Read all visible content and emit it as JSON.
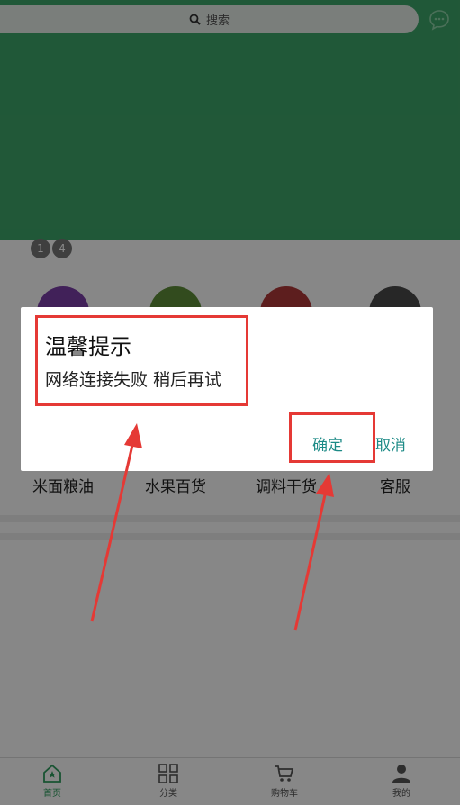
{
  "search": {
    "placeholder": "搜索"
  },
  "pager": {
    "current": "1",
    "total": "4"
  },
  "categories": [
    {
      "label": "米面粮油",
      "color": "#7b3fa8"
    },
    {
      "label": "水果百货",
      "color": "#5f8f3a"
    },
    {
      "label": "调料干货",
      "color": "#b03a3a"
    },
    {
      "label": "客服",
      "color": "#4a4a4a"
    }
  ],
  "tabbar": [
    {
      "label": "首页"
    },
    {
      "label": "分类"
    },
    {
      "label": "购物车"
    },
    {
      "label": "我的"
    }
  ],
  "dialog": {
    "title": "温馨提示",
    "message": "网络连接失败 稍后再试",
    "confirm": "确定",
    "cancel": "取消"
  },
  "colors": {
    "brand": "#3ea66a",
    "dialog_button": "#1c8a86",
    "highlight": "#e53935"
  }
}
